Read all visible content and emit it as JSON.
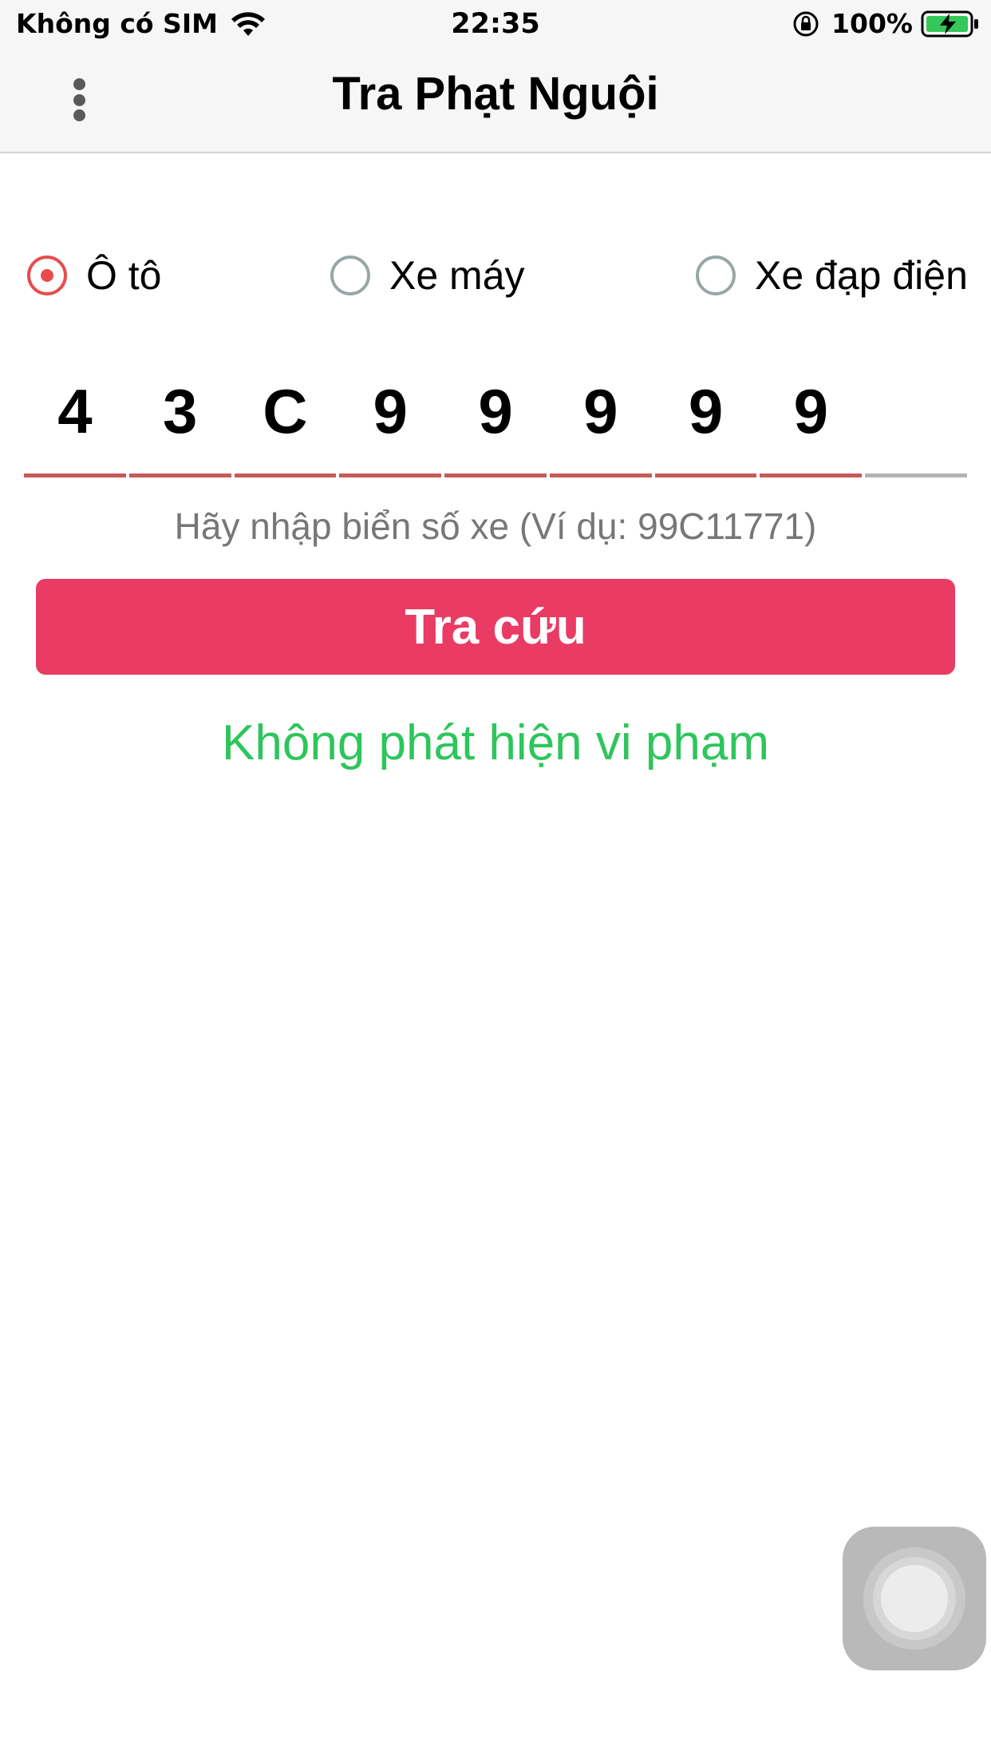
{
  "status_bar": {
    "carrier": "Không có SIM",
    "time": "22:35",
    "battery_percent": "100%",
    "icons": [
      "wifi-icon",
      "rotation-lock-icon",
      "battery-charging-icon"
    ]
  },
  "nav": {
    "title": "Tra Phạt Nguội",
    "menu_icon": "more-vertical-icon"
  },
  "vehicle_types": {
    "selected": "Ô tô",
    "options": [
      {
        "label": "Ô tô",
        "selected": true
      },
      {
        "label": "Xe máy",
        "selected": false
      },
      {
        "label": "Xe đạp điện",
        "selected": false
      }
    ]
  },
  "plate": {
    "chars": [
      "4",
      "3",
      "C",
      "9",
      "9",
      "9",
      "9",
      "9",
      ""
    ],
    "hint": "Hãy nhập biển số xe (Ví dụ: 99C11771)"
  },
  "search_button": {
    "label": "Tra cứu"
  },
  "result": {
    "text": "Không phát hiện vi phạm"
  },
  "colors": {
    "accent": "#e93b63",
    "radio_selected": "#e74c4c",
    "underline_filled": "#c85a5a",
    "underline_empty": "#b3b3b3",
    "success": "#2ec55c"
  }
}
